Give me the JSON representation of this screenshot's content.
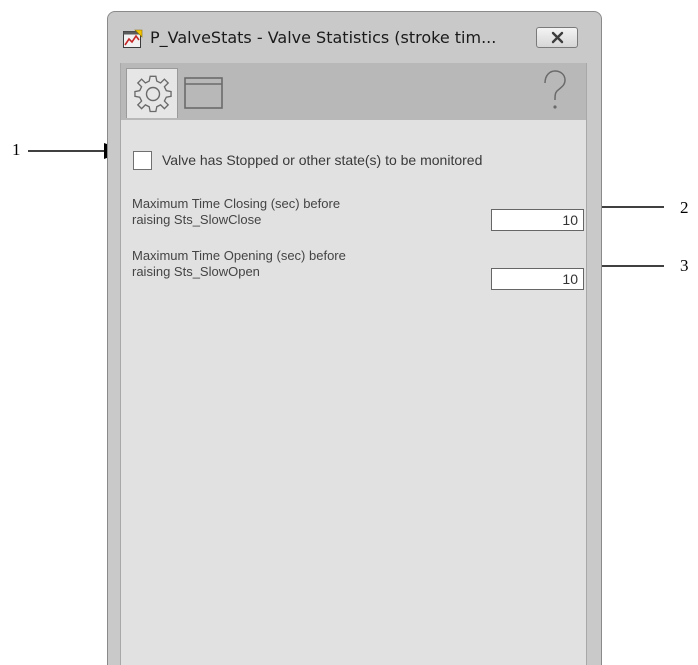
{
  "window": {
    "title": "P_ValveStats - Valve Statistics (stroke tim..."
  },
  "toolbar": {
    "tabs": [
      {
        "icon": "gear-icon",
        "label": "Configuration"
      },
      {
        "icon": "window-icon",
        "label": "Display"
      }
    ],
    "help_icon": "help-question-icon"
  },
  "settings": {
    "stopped_checkbox": {
      "label": "Valve has Stopped or other state(s) to be monitored",
      "checked": false
    },
    "max_time_closing": {
      "label_line1": "Maximum Time Closing (sec) before",
      "label_line2": "raising Sts_SlowClose",
      "value": "10"
    },
    "max_time_opening": {
      "label_line1": "Maximum Time Opening (sec) before",
      "label_line2": "raising Sts_SlowOpen",
      "value": "10"
    }
  },
  "callouts": [
    "1",
    "2",
    "3"
  ],
  "colors": {
    "window_frame": "#c9c9c9",
    "client_bg": "#e1e1e1",
    "toolbar_bg": "#b8b8b8"
  }
}
